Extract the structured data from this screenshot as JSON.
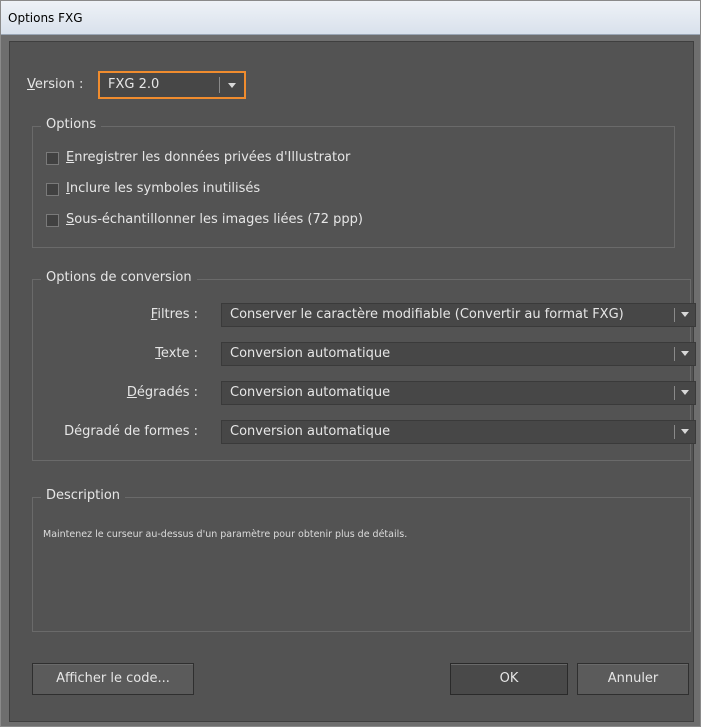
{
  "window": {
    "title": "Options FXG"
  },
  "version": {
    "label": "Version :",
    "selected": "FXG 2.0"
  },
  "options_group": {
    "title": "Options",
    "checkboxes": [
      {
        "label": "Enregistrer les données privées d'Illustrator",
        "checked": false
      },
      {
        "label": "Inclure les symboles inutilisés",
        "checked": false
      },
      {
        "label": "Sous-échantillonner les images liées (72 ppp)",
        "checked": false
      }
    ]
  },
  "conversion_group": {
    "title": "Options de conversion",
    "rows": [
      {
        "label": "Filtres :",
        "value": "Conserver le caractère modifiable (Convertir au format FXG)"
      },
      {
        "label": "Texte :",
        "value": "Conversion automatique"
      },
      {
        "label": "Dégradés :",
        "value": "Conversion automatique"
      },
      {
        "label": "Dégradé de formes :",
        "value": "Conversion automatique"
      }
    ]
  },
  "description_group": {
    "title": "Description",
    "text": "Maintenez le curseur au-dessus d'un paramètre pour obtenir plus de détails."
  },
  "buttons": {
    "show_code": "Afficher le code...",
    "ok": "OK",
    "cancel": "Annuler"
  },
  "icons": {
    "dropdown": "chevron-down-icon"
  },
  "colors": {
    "focus_accent": "#f08c2e",
    "panel_bg": "#535353",
    "field_bg": "#474747"
  }
}
